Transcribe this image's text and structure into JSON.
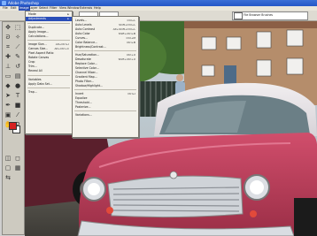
{
  "window": {
    "title": "Adobe Photoshop"
  },
  "menubar": {
    "items": [
      "File",
      "Edit",
      "Image",
      "Layer",
      "Select",
      "Filter",
      "View",
      "Window",
      "Extensis",
      "Help"
    ]
  },
  "optionsbar": {
    "dropdown_a": "",
    "dropdown_b": "",
    "right_label": "File Browser  Brushes"
  },
  "image_menu": {
    "items": [
      {
        "label": "Mode",
        "shortcut": ""
      },
      {
        "label": "Adjustments",
        "shortcut": ""
      },
      {
        "label": "Duplicate...",
        "shortcut": ""
      },
      {
        "label": "Apply Image...",
        "shortcut": ""
      },
      {
        "label": "Calculations...",
        "shortcut": ""
      },
      {
        "label": "Image Size...",
        "shortcut": "Alt+Ctrl+I"
      },
      {
        "label": "Canvas Size...",
        "shortcut": "Alt+Ctrl+C"
      },
      {
        "label": "Pixel Aspect Ratio",
        "shortcut": ""
      },
      {
        "label": "Rotate Canvas",
        "shortcut": ""
      },
      {
        "label": "Crop",
        "shortcut": ""
      },
      {
        "label": "Trim...",
        "shortcut": ""
      },
      {
        "label": "Reveal All",
        "shortcut": ""
      },
      {
        "label": "Variables",
        "shortcut": ""
      },
      {
        "label": "Apply Data Set...",
        "shortcut": ""
      },
      {
        "label": "Trap...",
        "shortcut": ""
      }
    ]
  },
  "adjust_menu": {
    "items": [
      {
        "label": "Levels...",
        "shortcut": "Ctrl+L"
      },
      {
        "label": "Auto Levels",
        "shortcut": "Shift+Ctrl+L"
      },
      {
        "label": "Auto Contrast",
        "shortcut": "Alt+Shift+Ctrl+L"
      },
      {
        "label": "Auto Color",
        "shortcut": "Shift+Ctrl+B"
      },
      {
        "label": "Curves...",
        "shortcut": "Ctrl+M"
      },
      {
        "label": "Color Balance...",
        "shortcut": "Ctrl+B"
      },
      {
        "label": "Brightness/Contrast...",
        "shortcut": ""
      },
      {
        "label": "Hue/Saturation...",
        "shortcut": "Ctrl+U"
      },
      {
        "label": "Desaturate",
        "shortcut": "Shift+Ctrl+U"
      },
      {
        "label": "Replace Color...",
        "shortcut": ""
      },
      {
        "label": "Selective Color...",
        "shortcut": ""
      },
      {
        "label": "Channel Mixer...",
        "shortcut": ""
      },
      {
        "label": "Gradient Map...",
        "shortcut": ""
      },
      {
        "label": "Photo Filter...",
        "shortcut": ""
      },
      {
        "label": "Shadow/Highlight...",
        "shortcut": ""
      },
      {
        "label": "Invert",
        "shortcut": "Ctrl+I"
      },
      {
        "label": "Equalize",
        "shortcut": ""
      },
      {
        "label": "Threshold...",
        "shortcut": ""
      },
      {
        "label": "Posterize...",
        "shortcut": ""
      },
      {
        "label": "Variations...",
        "shortcut": ""
      }
    ]
  },
  "colors": {
    "foreground": "#d52020",
    "background": "#ffffff",
    "car_body": "#c4425f",
    "highlight": "#2b4fb8"
  }
}
